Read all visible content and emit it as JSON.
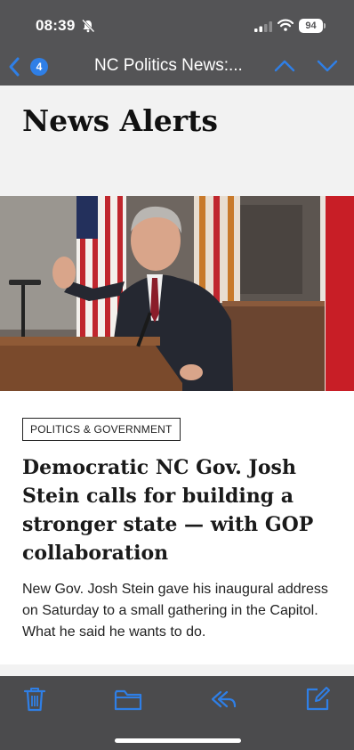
{
  "status_bar": {
    "time": "08:39",
    "battery_level": "94",
    "icons": [
      "bell-slash-icon",
      "signal-icon",
      "wifi-icon",
      "battery-icon"
    ]
  },
  "nav": {
    "unread_count": "4",
    "title": "NC Politics News:...",
    "icons": [
      "back-chevron-icon",
      "up-chevron-icon",
      "down-chevron-icon"
    ]
  },
  "email": {
    "section_title": "News Alerts",
    "tag": "POLITICS & GOVERNMENT",
    "headline": "Democratic NC Gov. Josh Stein calls for building a stronger state — with GOP collaboration",
    "summary": "New Gov. Josh Stein gave his inaugural address on Saturday to a small gathering in the Capitol. What he said he wants to do."
  },
  "toolbar": {
    "icons": [
      "trash-icon",
      "folder-icon",
      "reply-icon",
      "compose-icon"
    ]
  },
  "colors": {
    "accent": "#2f7fe6",
    "bar": "#545456",
    "toolbar": "#4b4b4d"
  }
}
